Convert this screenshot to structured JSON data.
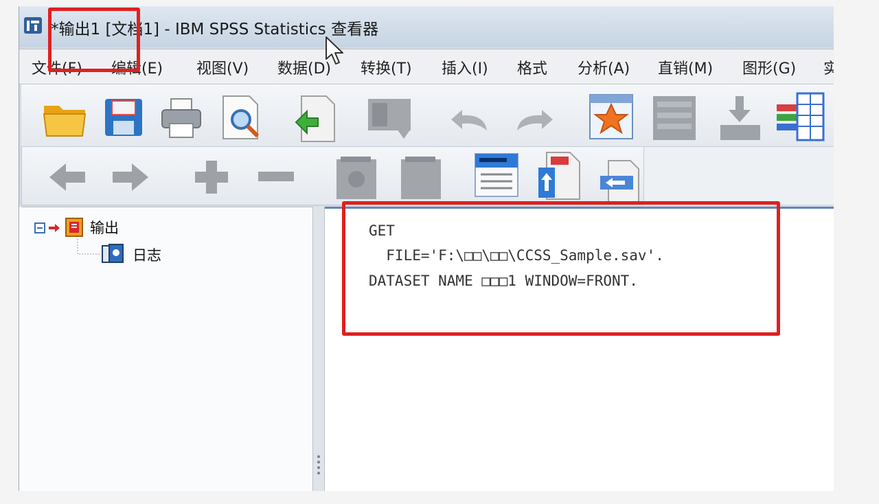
{
  "window": {
    "title": "*输出1 [文档1] - IBM SPSS Statistics 查看器"
  },
  "menu": [
    {
      "label": "文件(F)"
    },
    {
      "label": "编辑(E)"
    },
    {
      "label": "视图(V)"
    },
    {
      "label": "数据(D)"
    },
    {
      "label": "转换(T)"
    },
    {
      "label": "插入(I)"
    },
    {
      "label": "格式"
    },
    {
      "label": "分析(A)"
    },
    {
      "label": "直销(M)"
    },
    {
      "label": "图形(G)"
    },
    {
      "label": "实"
    }
  ],
  "toolbar1": [
    {
      "icon": "open-folder-icon",
      "enabled": true
    },
    {
      "icon": "save-icon",
      "enabled": true
    },
    {
      "icon": "print-icon",
      "enabled": true
    },
    {
      "icon": "print-preview-icon",
      "enabled": true
    },
    {
      "icon": "export-icon",
      "enabled": true
    },
    {
      "icon": "recall-dialog-icon",
      "enabled": false
    },
    {
      "icon": "undo-icon",
      "enabled": false
    },
    {
      "icon": "redo-icon",
      "enabled": false
    },
    {
      "icon": "goto-data-icon",
      "enabled": true
    },
    {
      "icon": "goto-case-icon",
      "enabled": false
    },
    {
      "icon": "goto-variable-icon",
      "enabled": false
    },
    {
      "icon": "variables-icon",
      "enabled": true
    }
  ],
  "toolbar2": [
    {
      "icon": "promote-icon",
      "enabled": false
    },
    {
      "icon": "demote-icon",
      "enabled": false
    },
    {
      "icon": "expand-icon",
      "enabled": false
    },
    {
      "icon": "collapse-icon",
      "enabled": false
    },
    {
      "icon": "show-icon",
      "enabled": false
    },
    {
      "icon": "hide-icon",
      "enabled": false
    },
    {
      "icon": "insert-heading-icon",
      "enabled": true
    },
    {
      "icon": "insert-title-icon",
      "enabled": true
    },
    {
      "icon": "insert-text-icon",
      "enabled": true
    }
  ],
  "outline": {
    "root_label": "输出",
    "child_label": "日志"
  },
  "log": {
    "lines": [
      "GET",
      "  FILE='F:\\□□\\□□\\CCSS_Sample.sav'.",
      "DATASET NAME □□□1 WINDOW=FRONT."
    ]
  },
  "colors": {
    "highlight": "#e0201f",
    "pane_divider": "#5d86c4"
  }
}
